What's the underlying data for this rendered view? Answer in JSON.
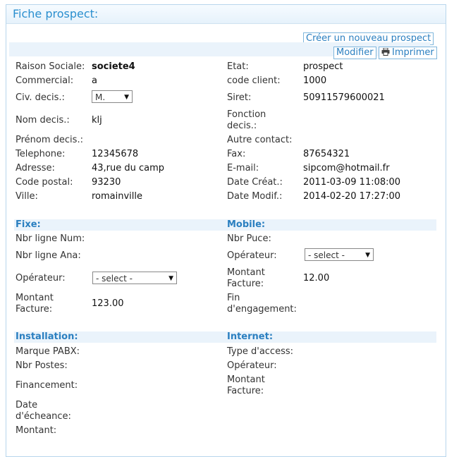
{
  "title": "Fiche prospect:",
  "buttons": {
    "create": "Créer un nouveau prospect",
    "modify": "Modifier",
    "print": "Imprimer"
  },
  "left_fields": [
    {
      "label": "Raison Sociale:",
      "value": "societe4"
    },
    {
      "label": "Commercial:",
      "value": "a"
    },
    {
      "label": "Civ. decis.:",
      "value": "M."
    },
    {
      "label": "Nom decis.:",
      "value": "klj"
    },
    {
      "label": "Prénom decis.:",
      "value": ""
    },
    {
      "label": "Telephone:",
      "value": "12345678"
    },
    {
      "label": "Adresse:",
      "value": "43,rue du camp"
    },
    {
      "label": "Code postal:",
      "value": "93230"
    },
    {
      "label": "Ville:",
      "value": "romainville"
    }
  ],
  "right_fields": [
    {
      "label": "Etat:",
      "value": "prospect"
    },
    {
      "label": "code client:",
      "value": "1000"
    },
    {
      "label": "Siret:",
      "value": "50911579600021"
    },
    {
      "label": "Fonction decis.:",
      "value": ""
    },
    {
      "label": "Autre contact:",
      "value": ""
    },
    {
      "label": "Fax:",
      "value": "87654321"
    },
    {
      "label": "E-mail:",
      "value": "sipcom@hotmail.fr"
    },
    {
      "label": "Date Créat.:",
      "value": "2011-03-09 11:08:00"
    },
    {
      "label": "Date Modif.:",
      "value": "2014-02-20 17:27:00"
    }
  ],
  "fixe": {
    "heading": "Fixe:",
    "nbr_ligne_num": "Nbr ligne Num:",
    "nbr_ligne_ana": "Nbr ligne Ana:",
    "operateur_label": "Opérateur:",
    "operateur_select": "- select -",
    "montant_label": "Montant Facture:",
    "montant_value": "123.00"
  },
  "mobile": {
    "heading": "Mobile:",
    "nbr_puce": "Nbr Puce:",
    "operateur_label": "Opérateur:",
    "operateur_select": "- select -",
    "montant_label": "Montant Facture:",
    "montant_value": "12.00",
    "fin_label": "Fin d'engagement:"
  },
  "installation": {
    "heading": "Installation:",
    "marque": "Marque PABX:",
    "postes": "Nbr Postes:",
    "financement": "Financement:",
    "echeance": "Date d'écheance:",
    "montant": "Montant:"
  },
  "internet": {
    "heading": "Internet:",
    "type": "Type d'access:",
    "operateur": "Opérateur:",
    "montant": "Montant Facture:"
  },
  "icons": {
    "print": "printer-icon",
    "dropdown": "chevron-down-icon"
  },
  "colors": {
    "accent": "#2a8fcf",
    "band": "#eaf3fb",
    "border": "#b8d6ec"
  }
}
